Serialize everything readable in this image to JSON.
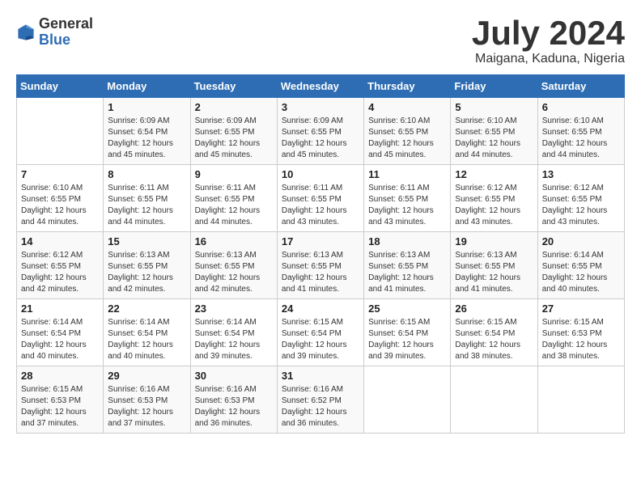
{
  "header": {
    "logo_general": "General",
    "logo_blue": "Blue",
    "title": "July 2024",
    "location": "Maigana, Kaduna, Nigeria"
  },
  "days_of_week": [
    "Sunday",
    "Monday",
    "Tuesday",
    "Wednesday",
    "Thursday",
    "Friday",
    "Saturday"
  ],
  "weeks": [
    [
      {
        "day": "",
        "info": ""
      },
      {
        "day": "1",
        "info": "Sunrise: 6:09 AM\nSunset: 6:54 PM\nDaylight: 12 hours\nand 45 minutes."
      },
      {
        "day": "2",
        "info": "Sunrise: 6:09 AM\nSunset: 6:55 PM\nDaylight: 12 hours\nand 45 minutes."
      },
      {
        "day": "3",
        "info": "Sunrise: 6:09 AM\nSunset: 6:55 PM\nDaylight: 12 hours\nand 45 minutes."
      },
      {
        "day": "4",
        "info": "Sunrise: 6:10 AM\nSunset: 6:55 PM\nDaylight: 12 hours\nand 45 minutes."
      },
      {
        "day": "5",
        "info": "Sunrise: 6:10 AM\nSunset: 6:55 PM\nDaylight: 12 hours\nand 44 minutes."
      },
      {
        "day": "6",
        "info": "Sunrise: 6:10 AM\nSunset: 6:55 PM\nDaylight: 12 hours\nand 44 minutes."
      }
    ],
    [
      {
        "day": "7",
        "info": "Sunrise: 6:10 AM\nSunset: 6:55 PM\nDaylight: 12 hours\nand 44 minutes."
      },
      {
        "day": "8",
        "info": "Sunrise: 6:11 AM\nSunset: 6:55 PM\nDaylight: 12 hours\nand 44 minutes."
      },
      {
        "day": "9",
        "info": "Sunrise: 6:11 AM\nSunset: 6:55 PM\nDaylight: 12 hours\nand 44 minutes."
      },
      {
        "day": "10",
        "info": "Sunrise: 6:11 AM\nSunset: 6:55 PM\nDaylight: 12 hours\nand 43 minutes."
      },
      {
        "day": "11",
        "info": "Sunrise: 6:11 AM\nSunset: 6:55 PM\nDaylight: 12 hours\nand 43 minutes."
      },
      {
        "day": "12",
        "info": "Sunrise: 6:12 AM\nSunset: 6:55 PM\nDaylight: 12 hours\nand 43 minutes."
      },
      {
        "day": "13",
        "info": "Sunrise: 6:12 AM\nSunset: 6:55 PM\nDaylight: 12 hours\nand 43 minutes."
      }
    ],
    [
      {
        "day": "14",
        "info": "Sunrise: 6:12 AM\nSunset: 6:55 PM\nDaylight: 12 hours\nand 42 minutes."
      },
      {
        "day": "15",
        "info": "Sunrise: 6:13 AM\nSunset: 6:55 PM\nDaylight: 12 hours\nand 42 minutes."
      },
      {
        "day": "16",
        "info": "Sunrise: 6:13 AM\nSunset: 6:55 PM\nDaylight: 12 hours\nand 42 minutes."
      },
      {
        "day": "17",
        "info": "Sunrise: 6:13 AM\nSunset: 6:55 PM\nDaylight: 12 hours\nand 41 minutes."
      },
      {
        "day": "18",
        "info": "Sunrise: 6:13 AM\nSunset: 6:55 PM\nDaylight: 12 hours\nand 41 minutes."
      },
      {
        "day": "19",
        "info": "Sunrise: 6:13 AM\nSunset: 6:55 PM\nDaylight: 12 hours\nand 41 minutes."
      },
      {
        "day": "20",
        "info": "Sunrise: 6:14 AM\nSunset: 6:55 PM\nDaylight: 12 hours\nand 40 minutes."
      }
    ],
    [
      {
        "day": "21",
        "info": "Sunrise: 6:14 AM\nSunset: 6:54 PM\nDaylight: 12 hours\nand 40 minutes."
      },
      {
        "day": "22",
        "info": "Sunrise: 6:14 AM\nSunset: 6:54 PM\nDaylight: 12 hours\nand 40 minutes."
      },
      {
        "day": "23",
        "info": "Sunrise: 6:14 AM\nSunset: 6:54 PM\nDaylight: 12 hours\nand 39 minutes."
      },
      {
        "day": "24",
        "info": "Sunrise: 6:15 AM\nSunset: 6:54 PM\nDaylight: 12 hours\nand 39 minutes."
      },
      {
        "day": "25",
        "info": "Sunrise: 6:15 AM\nSunset: 6:54 PM\nDaylight: 12 hours\nand 39 minutes."
      },
      {
        "day": "26",
        "info": "Sunrise: 6:15 AM\nSunset: 6:54 PM\nDaylight: 12 hours\nand 38 minutes."
      },
      {
        "day": "27",
        "info": "Sunrise: 6:15 AM\nSunset: 6:53 PM\nDaylight: 12 hours\nand 38 minutes."
      }
    ],
    [
      {
        "day": "28",
        "info": "Sunrise: 6:15 AM\nSunset: 6:53 PM\nDaylight: 12 hours\nand 37 minutes."
      },
      {
        "day": "29",
        "info": "Sunrise: 6:16 AM\nSunset: 6:53 PM\nDaylight: 12 hours\nand 37 minutes."
      },
      {
        "day": "30",
        "info": "Sunrise: 6:16 AM\nSunset: 6:53 PM\nDaylight: 12 hours\nand 36 minutes."
      },
      {
        "day": "31",
        "info": "Sunrise: 6:16 AM\nSunset: 6:52 PM\nDaylight: 12 hours\nand 36 minutes."
      },
      {
        "day": "",
        "info": ""
      },
      {
        "day": "",
        "info": ""
      },
      {
        "day": "",
        "info": ""
      }
    ]
  ]
}
